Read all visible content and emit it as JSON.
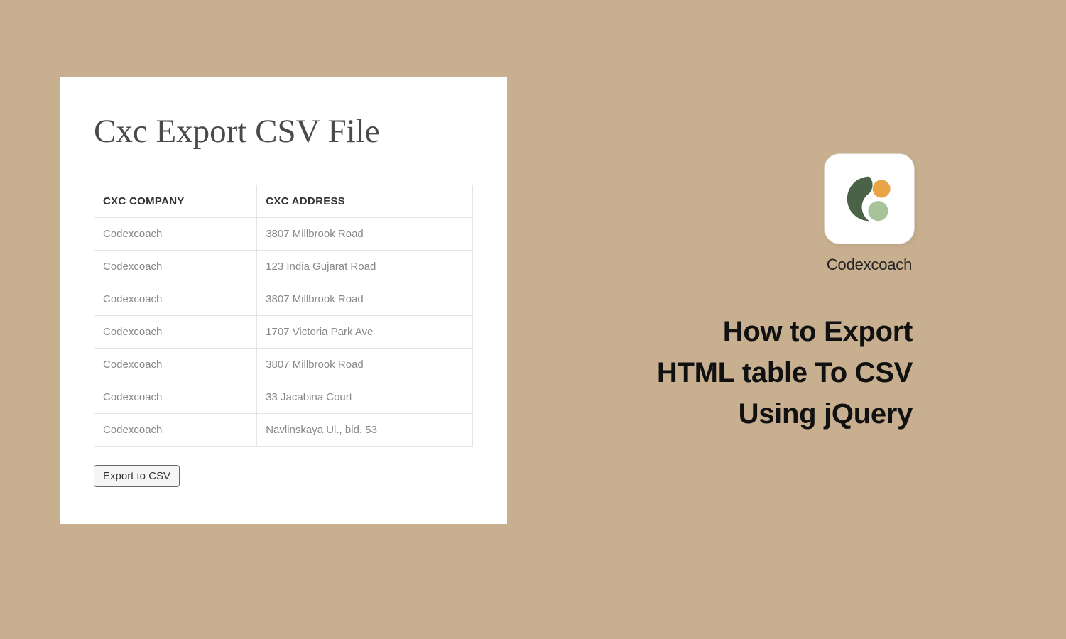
{
  "card": {
    "title": "Cxc Export CSV File",
    "table": {
      "headers": [
        "CXC COMPANY",
        "CXC ADDRESS"
      ],
      "rows": [
        [
          "Codexcoach",
          "3807 Millbrook Road"
        ],
        [
          "Codexcoach",
          "123 India Gujarat Road"
        ],
        [
          "Codexcoach",
          "3807 Millbrook Road"
        ],
        [
          "Codexcoach",
          "1707 Victoria Park Ave"
        ],
        [
          "Codexcoach",
          "3807 Millbrook Road"
        ],
        [
          "Codexcoach",
          "33 Jacabina Court"
        ],
        [
          "Codexcoach",
          "Navlinskaya Ul., bld. 53"
        ]
      ]
    },
    "export_button_label": "Export to CSV"
  },
  "brand": {
    "name": "Codexcoach"
  },
  "promo": {
    "line1": "How to Export",
    "line2": "HTML table To CSV",
    "line3": "Using jQuery"
  }
}
